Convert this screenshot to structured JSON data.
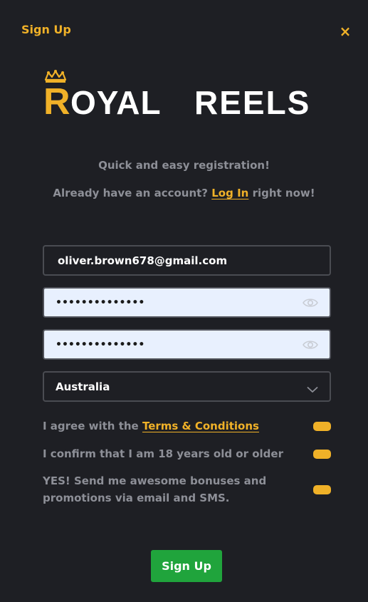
{
  "header": {
    "title": "Sign Up",
    "close_label": "×"
  },
  "logo": {
    "first_letter": "R",
    "rest_word1": "OYAL",
    "word2": "REELS"
  },
  "intro": {
    "tagline": "Quick and easy registration!",
    "login_prefix": "Already have an account?",
    "login_link": "Log In",
    "login_suffix": "right now!"
  },
  "form": {
    "email_value": "oliver.brown678@gmail.com",
    "password_mask": "••••••••••••••",
    "confirm_password_mask": "••••••••••••••",
    "country_value": "Australia"
  },
  "consents": {
    "terms_prefix": "I agree with the",
    "terms_link": "Terms & Conditions",
    "age_text": "I confirm that I am 18 years old or older",
    "promo_text": "YES! Send me awesome bonuses and promotions via email and SMS."
  },
  "actions": {
    "signup_label": "Sign Up"
  },
  "colors": {
    "background": "#1e1f24",
    "accent": "#f0b128",
    "muted_text": "#8d8f97",
    "button": "#20a43c"
  }
}
